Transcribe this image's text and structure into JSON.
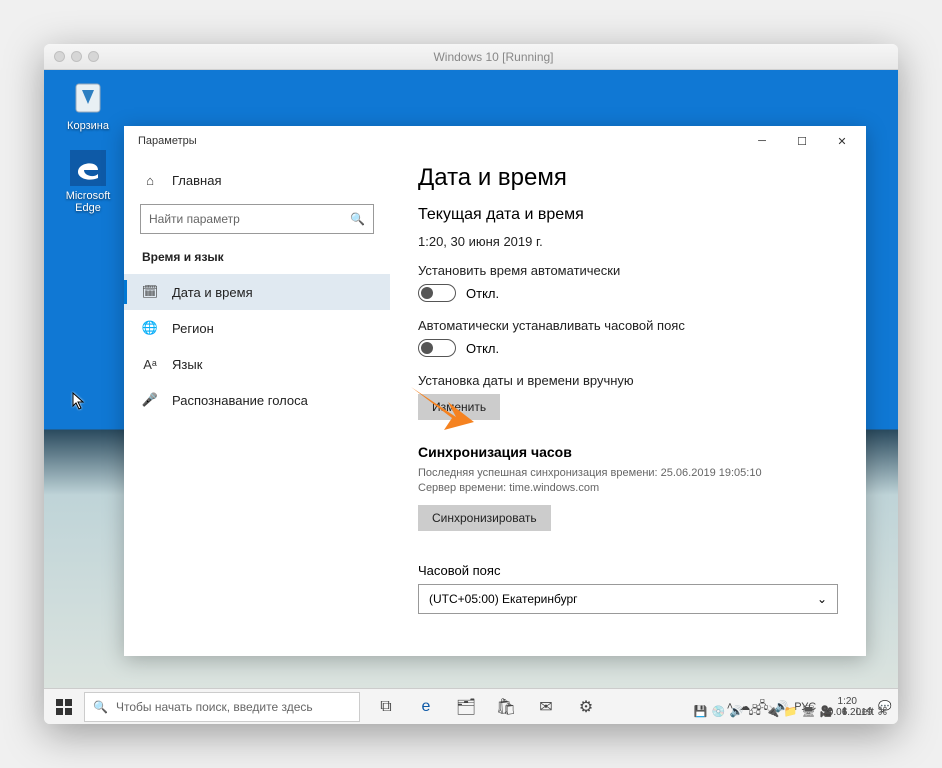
{
  "mac": {
    "title": "Windows 10 [Running]"
  },
  "desktop": {
    "recycle_label": "Корзина",
    "edge_label": "Microsoft Edge"
  },
  "settings": {
    "window_title": "Параметры",
    "home": "Главная",
    "search_placeholder": "Найти параметр",
    "section": "Время и язык",
    "nav": {
      "date_time": "Дата и время",
      "region": "Регион",
      "language": "Язык",
      "speech": "Распознавание голоса"
    },
    "main": {
      "title": "Дата и время",
      "current_heading": "Текущая дата и время",
      "current_value": "1:20, 30 июня 2019 г.",
      "auto_time_label": "Установить время автоматически",
      "auto_time_state": "Откл.",
      "auto_tz_label": "Автоматически устанавливать часовой пояс",
      "auto_tz_state": "Откл.",
      "manual_label": "Установка даты и времени вручную",
      "change_btn": "Изменить",
      "sync_heading": "Синхронизация часов",
      "sync_info_line1": "Последняя успешная синхронизация времени: 25.06.2019 19:05:10",
      "sync_info_line2": "Сервер времени: time.windows.com",
      "sync_btn": "Синхронизировать",
      "tz_label": "Часовой пояс",
      "tz_value": "(UTC+05:00) Екатеринбург"
    }
  },
  "taskbar": {
    "search_placeholder": "Чтобы начать поиск, введите здесь",
    "lang": "РУС",
    "time": "1:20",
    "date": "30.06.2019"
  },
  "host": {
    "right_text": "Left ⌘"
  }
}
